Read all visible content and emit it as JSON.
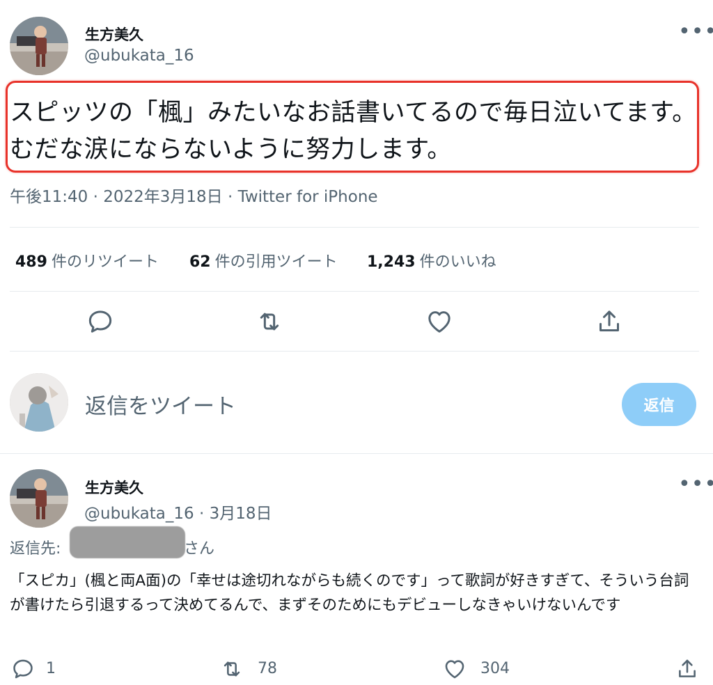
{
  "main_tweet": {
    "author_name": "生方美久",
    "author_handle": "@ubukata_16",
    "text": "スピッツの「楓」みたいなお話書いてるので毎日泣いてます。むだな涙にならないように努力します。",
    "meta": "午後11:40 · 2022年3月18日 · Twitter for iPhone",
    "stats": {
      "retweets_count": "489",
      "retweets_label": "件のリツイート",
      "quotes_count": "62",
      "quotes_label": "件の引用ツイート",
      "likes_count": "1,243",
      "likes_label": "件のいいね"
    },
    "actions": [
      "reply-icon",
      "retweet-icon",
      "like-icon",
      "share-icon"
    ],
    "highlight_color": "#e8322a"
  },
  "compose": {
    "placeholder": "返信をツイート",
    "reply_button": "返信"
  },
  "reply_tweet": {
    "author_name": "生方美久",
    "author_handle": "@ubukata_16",
    "date": "· 3月18日",
    "reply_to_prefix": "返信先:",
    "reply_to_suffix": "さん",
    "text": "「スピカ」(楓と両A面)の「幸せは途切れながらも続くのです」って歌詞が好きすぎて、そういう台詞が書けたら引退するって決めてるんで、まずそのためにもデビューしなきゃいけないんです",
    "reply_count": "1",
    "retweet_count": "78",
    "like_count": "304"
  },
  "colors": {
    "primary_text": "#0f1419",
    "secondary_text": "#536471",
    "reply_button_bg": "#8ecdf8",
    "divider": "#e6ebee"
  }
}
